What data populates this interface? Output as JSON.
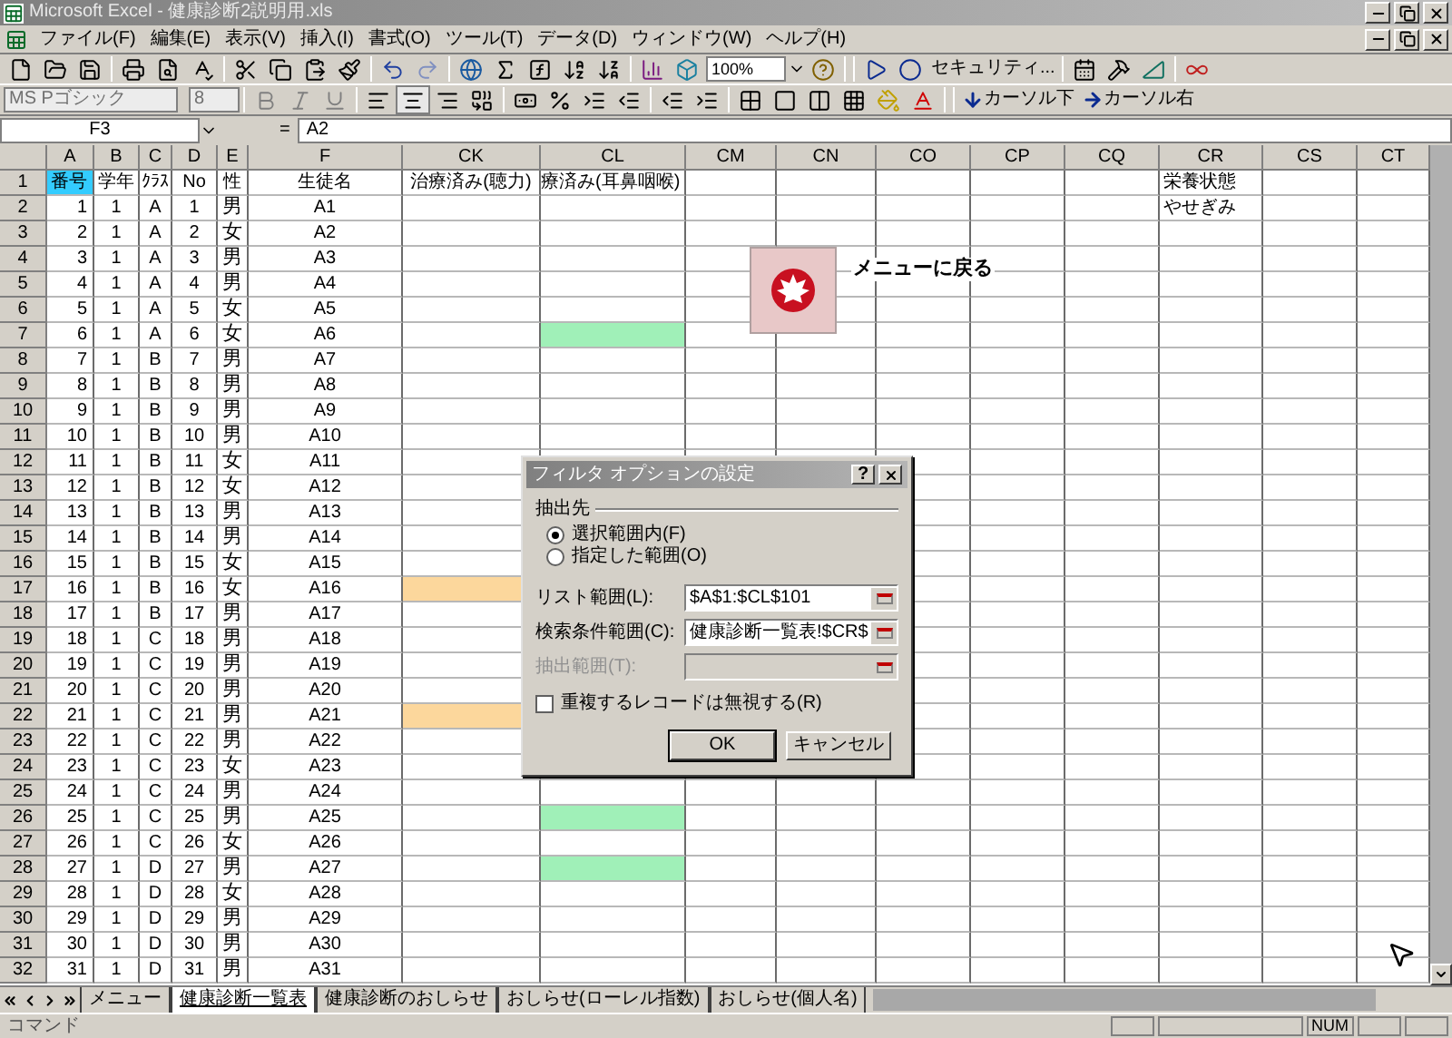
{
  "window": {
    "title": "Microsoft Excel - 健康診断2説明用.xls"
  },
  "menu_bar": [
    "ファイル(F)",
    "編集(E)",
    "表示(V)",
    "挿入(I)",
    "書式(O)",
    "ツール(T)",
    "データ(D)",
    "ウィンドウ(W)",
    "ヘルプ(H)"
  ],
  "toolbar": {
    "zoom": "100%",
    "security_button": "セキュリティ...",
    "font": "MS Pゴシック",
    "font_size": "8",
    "cursor_down": "カーソル下",
    "cursor_right": "カーソル右"
  },
  "formula_bar": {
    "name_box": "F3",
    "equals": "=",
    "value": "A2"
  },
  "columns": [
    "A",
    "B",
    "C",
    "D",
    "E",
    "F",
    "CK",
    "CL",
    "CM",
    "CN",
    "CO",
    "CP",
    "CQ",
    "CR",
    "CS",
    "CT"
  ],
  "rows": [
    {
      "row": "1",
      "kind": "header",
      "cells": [
        "番号",
        "学年",
        "ｸﾗｽ",
        "No",
        "性",
        "生徒名",
        "治療済み(聴力)",
        "療済み(耳鼻咽喉)"
      ],
      "cr": "栄養状態",
      "fills": {
        "A": {
          "color": "#33ccff"
        }
      }
    },
    {
      "row": "2",
      "kind": "data",
      "cells": [
        "1",
        "1",
        "A",
        "1",
        "男",
        "A1"
      ],
      "cr": "やせぎみ"
    },
    {
      "row": "3",
      "kind": "data",
      "cells": [
        "2",
        "1",
        "A",
        "2",
        "女",
        "A2"
      ]
    },
    {
      "row": "4",
      "kind": "data",
      "cells": [
        "3",
        "1",
        "A",
        "3",
        "男",
        "A3"
      ]
    },
    {
      "row": "5",
      "kind": "data",
      "cells": [
        "4",
        "1",
        "A",
        "4",
        "男",
        "A4"
      ]
    },
    {
      "row": "6",
      "kind": "data",
      "cells": [
        "5",
        "1",
        "A",
        "5",
        "女",
        "A5"
      ]
    },
    {
      "row": "7",
      "kind": "data",
      "cells": [
        "6",
        "1",
        "A",
        "6",
        "女",
        "A6"
      ],
      "fills": {
        "CL": {
          "color": "#a0f0b8"
        }
      }
    },
    {
      "row": "8",
      "kind": "data",
      "cells": [
        "7",
        "1",
        "B",
        "7",
        "男",
        "A7"
      ]
    },
    {
      "row": "9",
      "kind": "data",
      "cells": [
        "8",
        "1",
        "B",
        "8",
        "男",
        "A8"
      ]
    },
    {
      "row": "10",
      "kind": "data",
      "cells": [
        "9",
        "1",
        "B",
        "9",
        "男",
        "A9"
      ]
    },
    {
      "row": "11",
      "kind": "data",
      "cells": [
        "10",
        "1",
        "B",
        "10",
        "男",
        "A10"
      ]
    },
    {
      "row": "12",
      "kind": "data",
      "cells": [
        "11",
        "1",
        "B",
        "11",
        "女",
        "A11"
      ]
    },
    {
      "row": "13",
      "kind": "data",
      "cells": [
        "12",
        "1",
        "B",
        "12",
        "女",
        "A12"
      ]
    },
    {
      "row": "14",
      "kind": "data",
      "cells": [
        "13",
        "1",
        "B",
        "13",
        "男",
        "A13"
      ]
    },
    {
      "row": "15",
      "kind": "data",
      "cells": [
        "14",
        "1",
        "B",
        "14",
        "男",
        "A14"
      ]
    },
    {
      "row": "16",
      "kind": "data",
      "cells": [
        "15",
        "1",
        "B",
        "15",
        "女",
        "A15"
      ]
    },
    {
      "row": "17",
      "kind": "data",
      "cells": [
        "16",
        "1",
        "B",
        "16",
        "女",
        "A16"
      ],
      "fills": {
        "CK": {
          "color": "#fcd79c"
        }
      }
    },
    {
      "row": "18",
      "kind": "data",
      "cells": [
        "17",
        "1",
        "B",
        "17",
        "男",
        "A17"
      ]
    },
    {
      "row": "19",
      "kind": "data",
      "cells": [
        "18",
        "1",
        "C",
        "18",
        "男",
        "A18"
      ]
    },
    {
      "row": "20",
      "kind": "data",
      "cells": [
        "19",
        "1",
        "C",
        "19",
        "男",
        "A19"
      ]
    },
    {
      "row": "21",
      "kind": "data",
      "cells": [
        "20",
        "1",
        "C",
        "20",
        "男",
        "A20"
      ]
    },
    {
      "row": "22",
      "kind": "data",
      "cells": [
        "21",
        "1",
        "C",
        "21",
        "男",
        "A21"
      ],
      "fills": {
        "CK": {
          "color": "#fcd79c"
        }
      }
    },
    {
      "row": "23",
      "kind": "data",
      "cells": [
        "22",
        "1",
        "C",
        "22",
        "男",
        "A22"
      ]
    },
    {
      "row": "24",
      "kind": "data",
      "cells": [
        "23",
        "1",
        "C",
        "23",
        "女",
        "A23"
      ]
    },
    {
      "row": "25",
      "kind": "data",
      "cells": [
        "24",
        "1",
        "C",
        "24",
        "男",
        "A24"
      ]
    },
    {
      "row": "26",
      "kind": "data",
      "cells": [
        "25",
        "1",
        "C",
        "25",
        "男",
        "A25"
      ],
      "fills": {
        "CL": {
          "color": "#a0f0b8"
        }
      }
    },
    {
      "row": "27",
      "kind": "data",
      "cells": [
        "26",
        "1",
        "C",
        "26",
        "女",
        "A26"
      ]
    },
    {
      "row": "28",
      "kind": "data",
      "cells": [
        "27",
        "1",
        "D",
        "27",
        "男",
        "A27"
      ],
      "fills": {
        "CL": {
          "color": "#a0f0b8"
        }
      }
    },
    {
      "row": "29",
      "kind": "data",
      "cells": [
        "28",
        "1",
        "D",
        "28",
        "女",
        "A28"
      ]
    },
    {
      "row": "30",
      "kind": "data",
      "cells": [
        "29",
        "1",
        "D",
        "29",
        "男",
        "A29"
      ]
    },
    {
      "row": "31",
      "kind": "data",
      "cells": [
        "30",
        "1",
        "D",
        "30",
        "男",
        "A30"
      ]
    },
    {
      "row": "32",
      "kind": "data",
      "cells": [
        "31",
        "1",
        "D",
        "31",
        "男",
        "A31"
      ]
    }
  ],
  "menu_shortcut": {
    "label": "メニューに戻る"
  },
  "dialog": {
    "title": "フィルタ オプションの設定",
    "help_button": "?",
    "group_label": "抽出先",
    "options": [
      {
        "label": "選択範囲内(F)",
        "selected": true
      },
      {
        "label": "指定した範囲(O)",
        "selected": false
      }
    ],
    "fields": [
      {
        "label": "リスト範囲(L):",
        "value": "$A$1:$CL$101",
        "disabled": false
      },
      {
        "label": "検索条件範囲(C):",
        "value": "健康診断一覧表!$CR$",
        "disabled": false
      },
      {
        "label": "抽出範囲(T):",
        "disabled": true
      }
    ],
    "checkbox": {
      "label": "重複するレコードは無視する(R)",
      "checked": false
    },
    "buttons": [
      {
        "label": "OK",
        "default": true
      },
      {
        "label": "キャンセル",
        "default": false
      }
    ]
  },
  "sheet_tabs": [
    {
      "label": "メニュー",
      "selected": false
    },
    {
      "label": "健康診断一覧表",
      "selected": true
    },
    {
      "label": "健康診断のおしらせ",
      "selected": false
    },
    {
      "label": "おしらせ(ローレル指数)",
      "selected": false
    },
    {
      "label": "おしらせ(個人名)",
      "selected": false
    }
  ],
  "status_bar": {
    "mode": "コマンド",
    "indicators": [
      "NUM"
    ]
  }
}
